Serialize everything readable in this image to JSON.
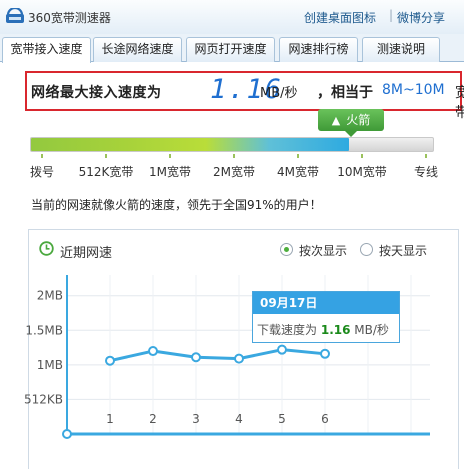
{
  "app": {
    "title": "360宽带测速器"
  },
  "header": {
    "link_desktop_icon": "创建桌面图标",
    "separator": "|",
    "link_share": "微博分享"
  },
  "tabs": [
    {
      "label": "宽带接入速度",
      "active": true
    },
    {
      "label": "长途网络速度",
      "active": false
    },
    {
      "label": "网页打开速度",
      "active": false
    },
    {
      "label": "网速排行榜",
      "active": false
    },
    {
      "label": "测速说明",
      "active": false
    }
  ],
  "result": {
    "label": "网络最大接入速度为",
    "value": "1.16",
    "unit": "MB/秒",
    "equivalent_label": "，相当于",
    "equivalent_range": "8M~10M",
    "equivalent_suffix": "宽带"
  },
  "speed_meter": {
    "badge_label": "火箭",
    "fill_fraction": 0.79,
    "levels": [
      "拨号",
      "512K宽带",
      "1M宽带",
      "2M宽带",
      "4M宽带",
      "10M宽带",
      "专线"
    ]
  },
  "compare_text": "当前的网速就像火箭的速度，领先于全国91%的用户！",
  "recent": {
    "title": "近期网速",
    "option_by_count": "按次显示",
    "option_by_day": "按天显示",
    "selected_option": "按次显示"
  },
  "tooltip": {
    "date": "09月17日",
    "label": "下载速度为",
    "value": "1.16",
    "unit": "MB/秒"
  },
  "colors": {
    "accent_blue": "#1f6fd0",
    "highlight_red": "#d9272e",
    "badge_green": "#4aa83e",
    "line_blue": "#3aa8e0",
    "tooltip_header": "#35a2e3"
  },
  "chart_data": {
    "type": "line",
    "x": [
      1,
      2,
      3,
      4,
      5,
      6
    ],
    "series": [
      {
        "values": [
          1.06,
          1.2,
          1.11,
          1.09,
          1.22,
          1.16
        ]
      }
    ],
    "y_ticks": [
      "2MB",
      "1.5MB",
      "1MB",
      "512KB"
    ],
    "y_tick_values": [
      2,
      1.5,
      1,
      0.5
    ],
    "ylim": [
      0,
      2.3
    ],
    "xlabel": "",
    "ylabel": "",
    "grid": true
  }
}
